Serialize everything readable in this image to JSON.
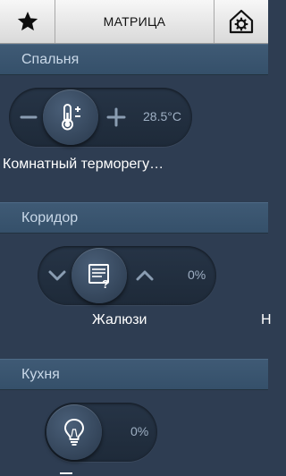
{
  "header": {
    "title": "МАТРИЦА",
    "favorites_icon": "star-icon",
    "settings_icon": "house-gear-icon"
  },
  "sections": [
    {
      "name": "Спальня",
      "device": {
        "label": "Комнатный терморегу…",
        "value": "28.5°C",
        "icon": "thermometer-icon",
        "left_control": "minus-icon",
        "right_control": "plus-icon"
      }
    },
    {
      "name": "Коридор",
      "device": {
        "label": "Жалюзи",
        "value": "0%",
        "icon": "blinds-icon",
        "left_control": "chevron-down-icon",
        "right_control": "chevron-up-icon"
      },
      "next_label_fragment": "Н"
    },
    {
      "name": "Кухня",
      "device": {
        "value": "0%",
        "icon": "lightbulb-icon"
      }
    }
  ]
}
